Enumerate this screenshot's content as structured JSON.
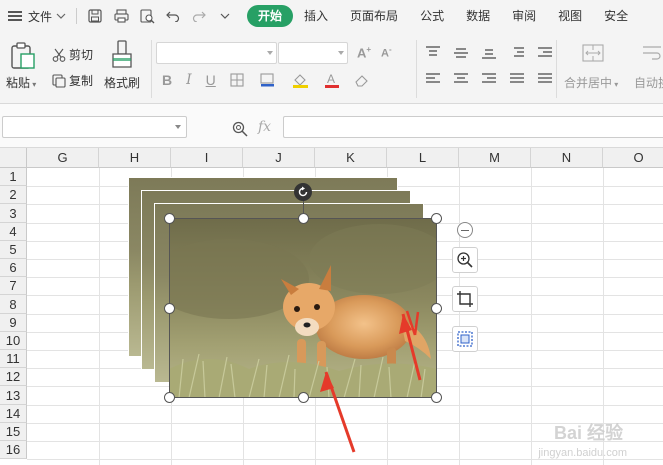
{
  "menubar": {
    "file_label": "文件",
    "tabs": [
      {
        "label": "开始",
        "active": true
      },
      {
        "label": "插入",
        "active": false
      },
      {
        "label": "页面布局",
        "active": false
      },
      {
        "label": "公式",
        "active": false
      },
      {
        "label": "数据",
        "active": false
      },
      {
        "label": "审阅",
        "active": false
      },
      {
        "label": "视图",
        "active": false
      },
      {
        "label": "安全",
        "active": false
      }
    ],
    "accent_color": "#27a065"
  },
  "ribbon": {
    "paste_label": "粘贴",
    "cut_label": "剪切",
    "copy_label": "复制",
    "format_painter_label": "格式刷",
    "merge_center_label": "合并居中",
    "wrap_label": "自动换"
  },
  "formula_bar": {
    "fx_label": "fx",
    "name_box_value": "",
    "formula_value": ""
  },
  "grid": {
    "columns": [
      "G",
      "H",
      "I",
      "J",
      "K",
      "L",
      "M",
      "N",
      "O"
    ],
    "rows": [
      "1",
      "2",
      "3",
      "4",
      "5",
      "6",
      "7",
      "8",
      "9",
      "10",
      "11",
      "12",
      "13",
      "14",
      "15",
      "16"
    ]
  },
  "image": {
    "subject": "fox kit in grass",
    "stack_count": 4
  },
  "side_tools": [
    "zoom-out",
    "zoom-in",
    "crop",
    "image-select"
  ],
  "watermark": {
    "brand": "Bai 经验",
    "url": "jingyan.baidu.com"
  }
}
